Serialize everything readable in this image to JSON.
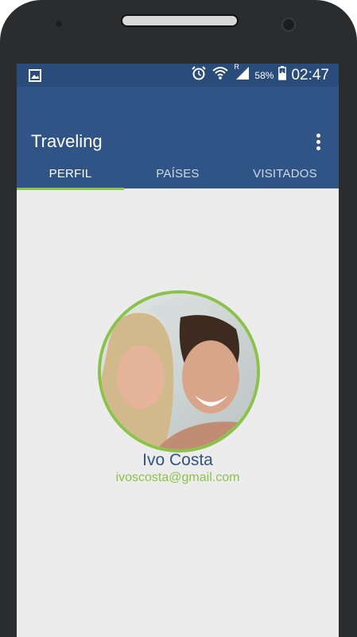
{
  "status_bar": {
    "battery_percent": "58%",
    "signal_label": "R",
    "time": "02:47",
    "icons": [
      "gallery-icon",
      "alarm-icon",
      "wifi-icon",
      "signal-icon",
      "battery-icon"
    ]
  },
  "app_bar": {
    "title": "Traveling",
    "menu_icon": "more-vert-icon"
  },
  "tabs": [
    {
      "label": "PERFIL",
      "active": true
    },
    {
      "label": "PAÍSES",
      "active": false
    },
    {
      "label": "VISITADOS",
      "active": false
    }
  ],
  "profile": {
    "name": "Ivo Costa",
    "email": "ivoscosta@gmail.com"
  },
  "colors": {
    "primary": "#2f5485",
    "primary_dark": "#2a4c7a",
    "accent": "#8bc34a",
    "background": "#ececec"
  }
}
